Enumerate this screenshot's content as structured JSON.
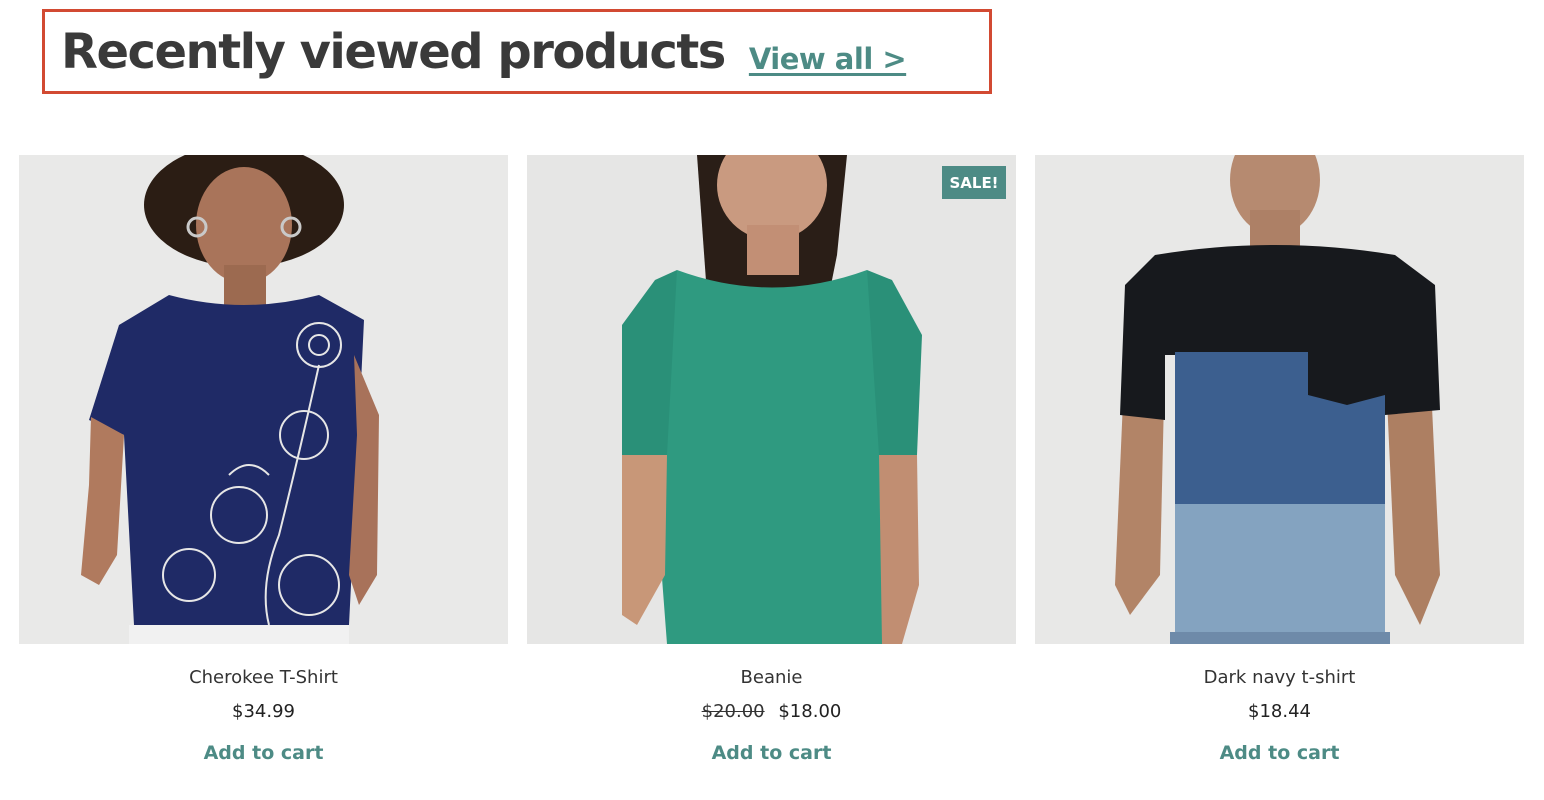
{
  "section": {
    "title": "Recently viewed products",
    "view_all_label": "View all >"
  },
  "colors": {
    "accent": "#4d8b85",
    "highlight_border": "#d24a32",
    "image_background": "#e7e7e6"
  },
  "products": [
    {
      "title": "Cherokee T-Shirt",
      "price": "$34.99",
      "regular_price": null,
      "on_sale": false,
      "badge": null,
      "add_to_cart_label": "Add to cart",
      "image_subject": "woman in navy floral-print t-shirt"
    },
    {
      "title": "Beanie",
      "price": "$18.00",
      "regular_price": "$20.00",
      "on_sale": true,
      "badge": "SALE!",
      "add_to_cart_label": "Add to cart",
      "image_subject": "woman in green fitted top"
    },
    {
      "title": "Dark navy t-shirt",
      "price": "$18.44",
      "regular_price": null,
      "on_sale": false,
      "badge": null,
      "add_to_cart_label": "Add to cart",
      "image_subject": "man in color-block t-shirt"
    }
  ]
}
